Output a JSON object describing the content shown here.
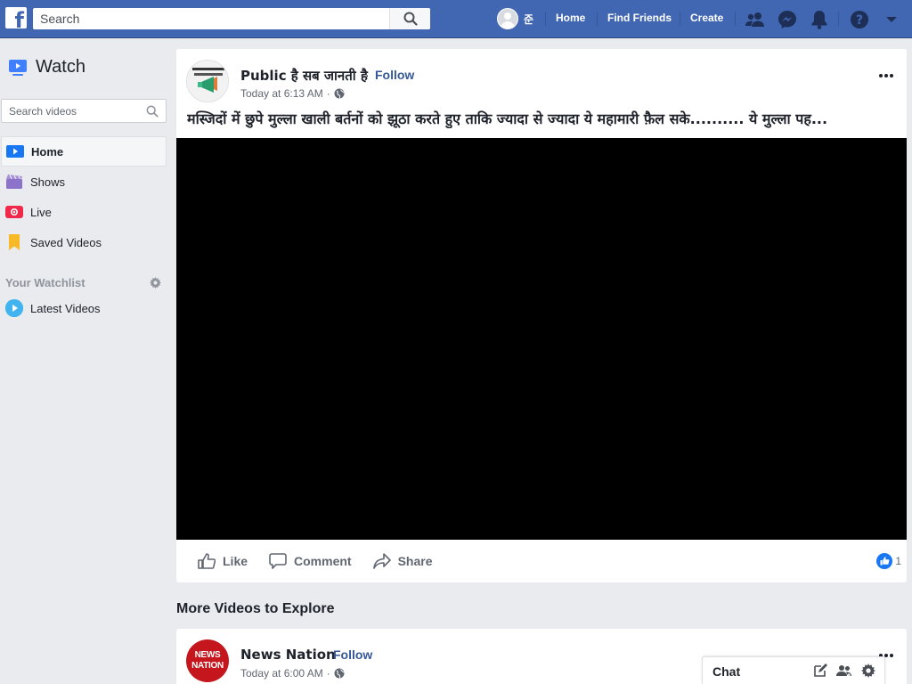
{
  "topbar": {
    "logo": "f",
    "search_placeholder": "Search",
    "username": "준",
    "links": [
      "Home",
      "Find Friends",
      "Create"
    ],
    "icons": [
      "friend-requests-icon",
      "messenger-icon",
      "notifications-icon",
      "help-icon",
      "dropdown-arrow-icon"
    ],
    "brand_color": "#4267b2"
  },
  "sidebar": {
    "title": "Watch",
    "search_placeholder": "Search videos",
    "items": [
      {
        "label": "Home",
        "icon": "watch-home-icon",
        "active": true
      },
      {
        "label": "Shows",
        "icon": "shows-icon"
      },
      {
        "label": "Live",
        "icon": "live-icon"
      },
      {
        "label": "Saved Videos",
        "icon": "saved-videos-icon"
      }
    ],
    "watchlist_title": "Your Watchlist",
    "watchlist_items": [
      {
        "label": "Latest Videos",
        "icon": "latest-videos-icon"
      }
    ]
  },
  "post": {
    "page_name": "Public है सब जानती है",
    "separator": "·",
    "follow": "Follow",
    "time": "Today at 6:13 AM",
    "privacy_sep": "·",
    "text": "मस्जिदों में छुपे मुल्ला खाली बर्तनों को झूठा करते हुए ताकि ज्यादा से ज्यादा ये महामारी फ़ैल सके.......... ये मुल्ला पह...",
    "actions": [
      "Like",
      "Comment",
      "Share"
    ],
    "reaction_count": "1"
  },
  "more_videos": {
    "heading": "More Videos to Explore",
    "post": {
      "page_name": "News Nation",
      "logo_line1": "NEWS",
      "logo_line2": "NATION",
      "separator": "·",
      "follow": "Follow",
      "time": "Today at 6:00 AM",
      "privacy_sep": "·"
    }
  },
  "chat": {
    "label": "Chat"
  }
}
